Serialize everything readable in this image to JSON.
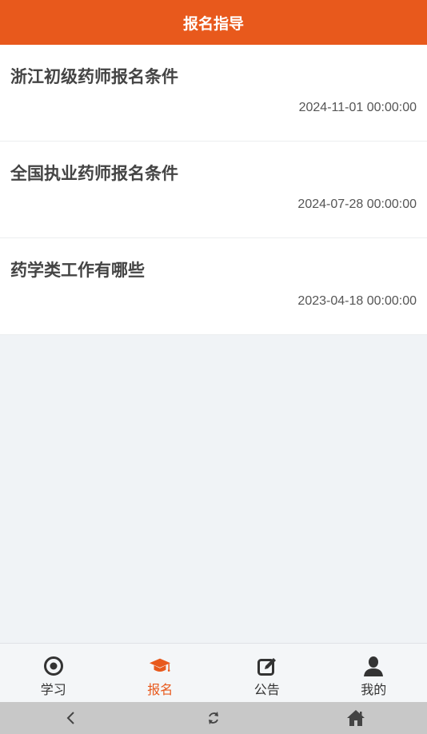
{
  "header": {
    "title": "报名指导"
  },
  "articles": [
    {
      "title": "浙江初级药师报名条件",
      "date": "2024-11-01 00:00:00"
    },
    {
      "title": "全国执业药师报名条件",
      "date": "2024-07-28 00:00:00"
    },
    {
      "title": "药学类工作有哪些",
      "date": "2023-04-18 00:00:00"
    }
  ],
  "tabbar": {
    "active": "报名",
    "tabs": [
      {
        "label": "学习",
        "icon": "target-icon"
      },
      {
        "label": "报名",
        "icon": "graduation-cap-icon"
      },
      {
        "label": "公告",
        "icon": "edit-icon"
      },
      {
        "label": "我的",
        "icon": "user-icon"
      }
    ]
  },
  "system_nav": {
    "buttons": [
      "back-icon",
      "refresh-icon",
      "home-icon"
    ]
  },
  "colors": {
    "accent": "#e8591c",
    "background": "#f0f3f6",
    "tab_inactive": "#333333"
  }
}
